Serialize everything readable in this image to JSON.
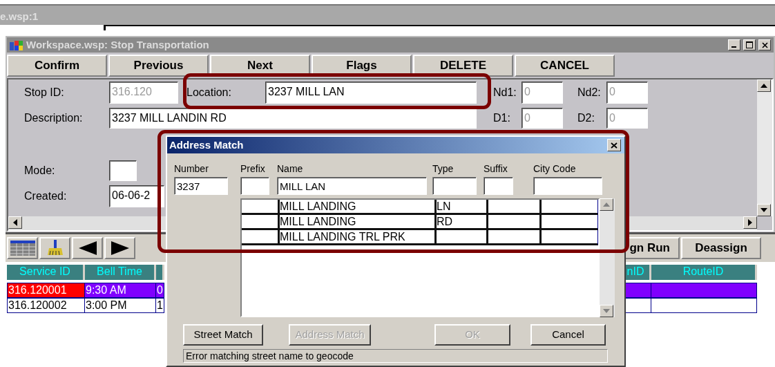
{
  "background_window": {
    "title": "e.wsp:1"
  },
  "window": {
    "title": "Workspace.wsp:  Stop Transportation"
  },
  "toolbar": [
    "Confirm",
    "Previous",
    "Next",
    "Flags",
    "DELETE",
    "CANCEL"
  ],
  "form_rows": [
    [
      {
        "label": "Stop ID:",
        "value": "316.120",
        "disabled": true
      },
      {
        "label": "Location:",
        "value": "3237 MILL LAN",
        "disabled": false
      },
      {
        "label": "Nd1:",
        "value": "0",
        "disabled": true
      },
      {
        "label": "Nd2:",
        "value": "0",
        "disabled": true
      }
    ],
    [
      {
        "label": "Description:",
        "value": "3237 MILL LANDIN RD",
        "disabled": false
      },
      {
        "label": "D1:",
        "value": "0",
        "disabled": true
      },
      {
        "label": "D2:",
        "value": "0",
        "disabled": true
      }
    ],
    [
      {
        "label": "Mode:"
      }
    ],
    [
      {
        "label": "Created:",
        "value": "06-06-2",
        "disabled": false
      }
    ]
  ],
  "lower_buttons": [
    "gn Run",
    "Deassign"
  ],
  "grid": {
    "columns": [
      "Service ID",
      "Bell Time",
      "",
      "nID",
      "RouteID"
    ],
    "rows": [
      {
        "service_id": "316.120001",
        "bell_time": "9:30 AM",
        "column_3": "0",
        "selected": true
      },
      {
        "service_id": "316.120002",
        "bell_time": "3:00 PM",
        "column_3": "1",
        "selected": false
      }
    ]
  },
  "dialog": {
    "title": "Address Match",
    "fields": [
      {
        "label": "Number",
        "value": "3237"
      },
      {
        "label": "Prefix"
      },
      {
        "label": "Name",
        "value": "MILL LAN"
      },
      {
        "label": "Type"
      },
      {
        "label": "Suffix"
      },
      {
        "label": "City Code"
      }
    ],
    "matches": [
      {
        "name": "MILL LANDING",
        "type": "LN"
      },
      {
        "name": "MILL LANDING",
        "type": "RD"
      },
      {
        "name": "MILL LANDING TRL PRK"
      }
    ],
    "buttons": [
      {
        "label": "Street Match",
        "disabled": false
      },
      {
        "label": "Address Match",
        "disabled": true
      },
      {
        "label": "OK",
        "disabled": true
      },
      {
        "label": "Cancel",
        "disabled": false
      }
    ],
    "status": "Error matching street name to geocode"
  }
}
